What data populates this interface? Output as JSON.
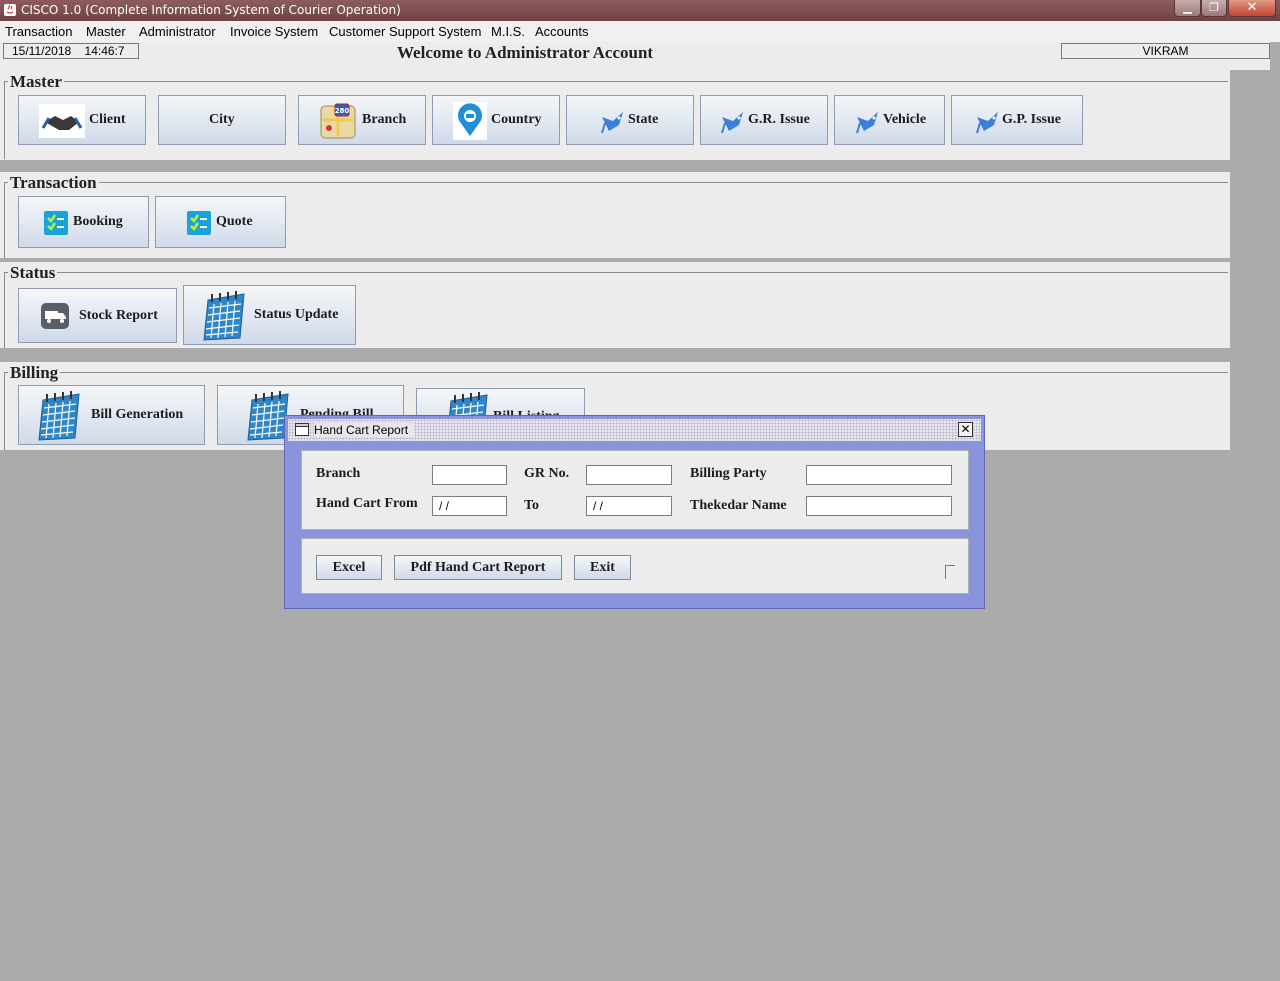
{
  "window": {
    "title": "CISCO 1.0 (Complete Information System of Courier Operation)",
    "min_glyph": "▁",
    "max_glyph": "❐",
    "close_glyph": "✕"
  },
  "menubar": {
    "items": [
      "Transaction",
      "Master",
      "Administrator",
      "Invoice System",
      "Customer Support System",
      "M.I.S.",
      "Accounts"
    ]
  },
  "infobar": {
    "date": "15/11/2018",
    "time": "14:46:7",
    "welcome": "Welcome to Administrator Account",
    "user": "VIKRAM"
  },
  "sections": {
    "master": {
      "title": "Master",
      "buttons": [
        {
          "label": "Client",
          "icon": "handshake-icon"
        },
        {
          "label": "City",
          "icon": ""
        },
        {
          "label": "Branch",
          "icon": "map-icon"
        },
        {
          "label": "Country",
          "icon": "location-pin-icon"
        },
        {
          "label": "State",
          "icon": "bird-icon"
        },
        {
          "label": "G.R. Issue",
          "icon": "bird-icon"
        },
        {
          "label": "Vehicle",
          "icon": "bird-icon"
        },
        {
          "label": "G.P. Issue",
          "icon": "bird-icon"
        }
      ]
    },
    "transaction": {
      "title": "Transaction",
      "buttons": [
        {
          "label": "Booking",
          "icon": "checklist-icon"
        },
        {
          "label": "Quote",
          "icon": "checklist-icon"
        }
      ]
    },
    "status": {
      "title": "Status",
      "buttons": [
        {
          "label": "Stock Report",
          "icon": "truck-icon"
        },
        {
          "label": "Status Update",
          "icon": "calendar-icon"
        }
      ]
    },
    "billing": {
      "title": "Billing",
      "buttons": [
        {
          "label": "Bill Generation",
          "icon": "calendar-icon"
        },
        {
          "label": "Pending Bill",
          "icon": "calendar-icon"
        },
        {
          "label": "Bill Listing",
          "icon": "calendar-icon"
        }
      ]
    }
  },
  "dialog": {
    "title": "Hand Cart Report",
    "close_glyph": "✕",
    "fields": {
      "branch": {
        "label": "Branch",
        "value": ""
      },
      "gr_no": {
        "label": "GR No.",
        "value": ""
      },
      "billing_party": {
        "label": "Billing Party",
        "value": ""
      },
      "hand_cart_from": {
        "label": "Hand Cart From",
        "value": "/ /"
      },
      "to": {
        "label": "To",
        "value": "/ /"
      },
      "thekedar_name": {
        "label": "Thekedar Name",
        "value": ""
      }
    },
    "buttons": {
      "excel": "Excel",
      "pdf": "Pdf Hand Cart Report",
      "exit": "Exit"
    }
  },
  "colors": {
    "desktop": "#ababab",
    "titlebar": "#7a4c4d",
    "dialog_frame": "#8a93dc",
    "panel": "#ececec"
  }
}
